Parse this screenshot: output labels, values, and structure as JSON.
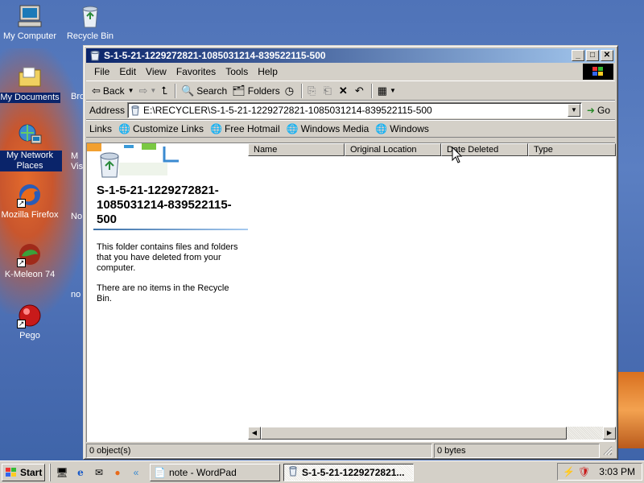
{
  "desktop": {
    "icons": [
      {
        "label": "My Computer",
        "icon": "my-computer-icon"
      },
      {
        "label": "Recycle Bin",
        "icon": "recycle-bin-icon"
      },
      {
        "label": "My Documents",
        "icon": "my-documents-icon"
      },
      {
        "label": "My Network Places",
        "icon": "network-places-icon"
      },
      {
        "label": "Mozilla Firefox",
        "icon": "firefox-icon"
      },
      {
        "label": "K-Meleon 74",
        "icon": "k-meleon-icon"
      },
      {
        "label": "Pego",
        "icon": "pego-icon"
      }
    ],
    "partial_labels": [
      "Bro",
      "M",
      "Visu",
      "No",
      "no"
    ]
  },
  "window": {
    "title": "S-1-5-21-1229272821-1085031214-839522115-500",
    "menu": [
      "File",
      "Edit",
      "View",
      "Favorites",
      "Tools",
      "Help"
    ],
    "toolbar": {
      "back": "Back",
      "search": "Search",
      "folders": "Folders"
    },
    "address": {
      "label": "Address",
      "value": "E:\\RECYCLER\\S-1-5-21-1229272821-1085031214-839522115-500",
      "go": "Go"
    },
    "links": {
      "label": "Links",
      "items": [
        "Customize Links",
        "Free Hotmail",
        "Windows Media",
        "Windows"
      ]
    },
    "left_pane": {
      "folder_title": "S-1-5-21-1229272821-1085031214-839522115-500",
      "description": "This folder contains files and folders that you have deleted from your computer.",
      "empty_message": "There are no items in the Recycle Bin."
    },
    "columns": [
      "Name",
      "Original Location",
      "Date Deleted",
      "Type"
    ],
    "status": {
      "objects": "0 object(s)",
      "size": "0 bytes"
    }
  },
  "taskbar": {
    "start": "Start",
    "tasks": [
      {
        "label": "note - WordPad",
        "active": false
      },
      {
        "label": "S-1-5-21-1229272821...",
        "active": true
      }
    ],
    "clock": "3:03 PM"
  },
  "colors": {
    "title_active_start": "#0a246a",
    "title_active_end": "#a6caf0",
    "face": "#d4d0c8",
    "desktop": "#4f73b8"
  }
}
